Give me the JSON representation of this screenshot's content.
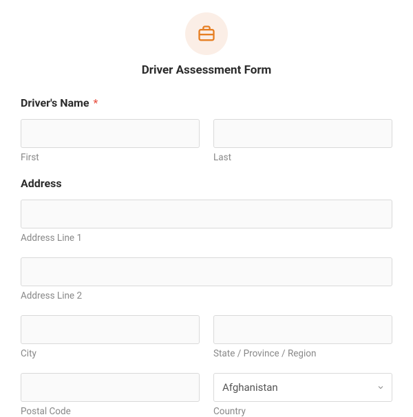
{
  "form": {
    "title": "Driver Assessment Form",
    "name_section": {
      "label": "Driver's Name",
      "required_mark": "*",
      "first_sub": "First",
      "last_sub": "Last"
    },
    "address_section": {
      "label": "Address",
      "line1_sub": "Address Line 1",
      "line2_sub": "Address Line 2",
      "city_sub": "City",
      "state_sub": "State / Province / Region",
      "postal_sub": "Postal Code",
      "country_sub": "Country",
      "country_selected": "Afghanistan"
    }
  }
}
